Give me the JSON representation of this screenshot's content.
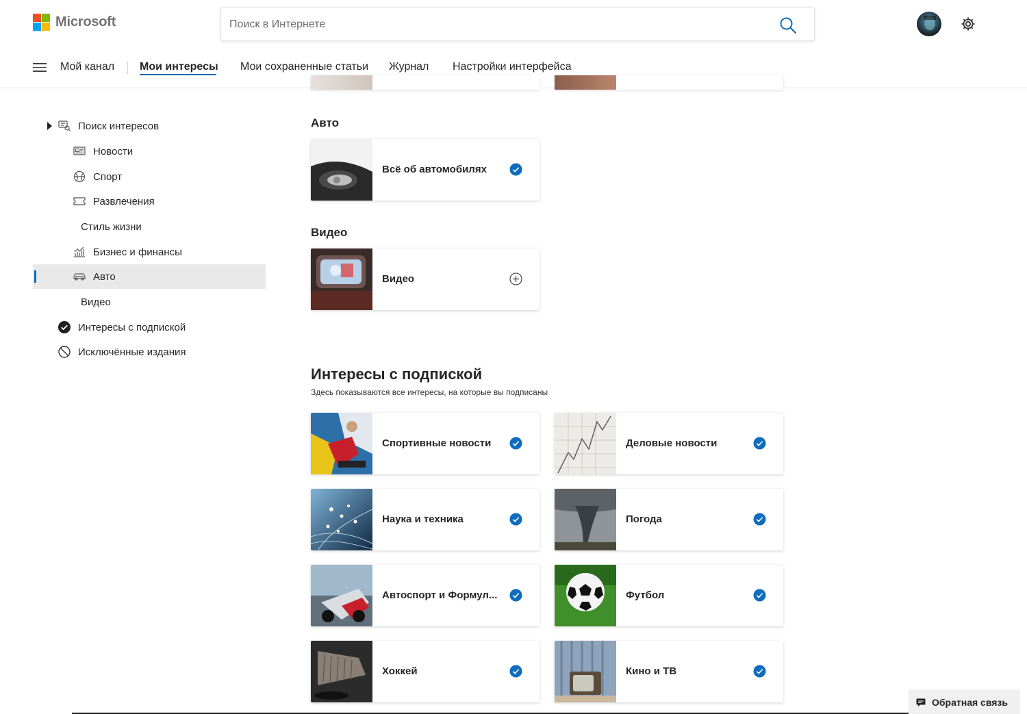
{
  "header": {
    "logo_text": "Microsoft",
    "logo_colors": [
      "#f25022",
      "#7fba00",
      "#00a4ef",
      "#ffb900"
    ],
    "search_placeholder": "Поиск в Интернете",
    "icons": [
      "search-icon",
      "avatar",
      "gear-icon"
    ]
  },
  "nav": {
    "items": [
      {
        "label": "Мой канал"
      },
      {
        "label": "Мои интересы",
        "active": true
      },
      {
        "label": "Мои сохраненные статьи"
      },
      {
        "label": "Журнал"
      },
      {
        "label": "Настройки интерфейса"
      }
    ],
    "accent": "#0f6cbd"
  },
  "sidebar": {
    "items": [
      {
        "label": "Поиск интересов",
        "icon": "discover-icon",
        "expandable": true
      },
      {
        "label": "Новости",
        "icon": "news-icon"
      },
      {
        "label": "Спорт",
        "icon": "sports-icon"
      },
      {
        "label": "Развлечения",
        "icon": "entertainment-icon"
      },
      {
        "label": "Стиль жизни",
        "icon": ""
      },
      {
        "label": "Бизнес и финансы",
        "icon": "finance-icon"
      },
      {
        "label": "Авто",
        "icon": "car-icon",
        "selected": true
      },
      {
        "label": "Видео",
        "icon": ""
      },
      {
        "label": "Интересы с подпиской",
        "icon": "check-circle-icon"
      },
      {
        "label": "Исключённые издания",
        "icon": "blocked-icon"
      }
    ]
  },
  "sections": {
    "auto": {
      "title": "Авто",
      "cards": [
        {
          "name": "Всё об автомобилях",
          "followed": true
        }
      ]
    },
    "video": {
      "title": "Видео",
      "cards": [
        {
          "name": "Видео",
          "followed": false
        }
      ]
    },
    "subscribed": {
      "title": "Интересы с подпиской",
      "subtitle": "Здесь показываются все интересы, на которые вы подписаны",
      "cards": [
        {
          "name": "Спортивные новости",
          "followed": true
        },
        {
          "name": "Деловые новости",
          "followed": true
        },
        {
          "name": "Наука и техника",
          "followed": true
        },
        {
          "name": "Погода",
          "followed": true
        },
        {
          "name": "Автоспорт и Формул...",
          "followed": true
        },
        {
          "name": "Футбол",
          "followed": true
        },
        {
          "name": "Хоккей",
          "followed": true
        },
        {
          "name": "Кино и ТВ",
          "followed": true
        }
      ]
    }
  },
  "feedback": {
    "label": "Обратная связь"
  },
  "colors": {
    "check": "#0f6cbd",
    "selected_bg": "#e9e9e9"
  }
}
